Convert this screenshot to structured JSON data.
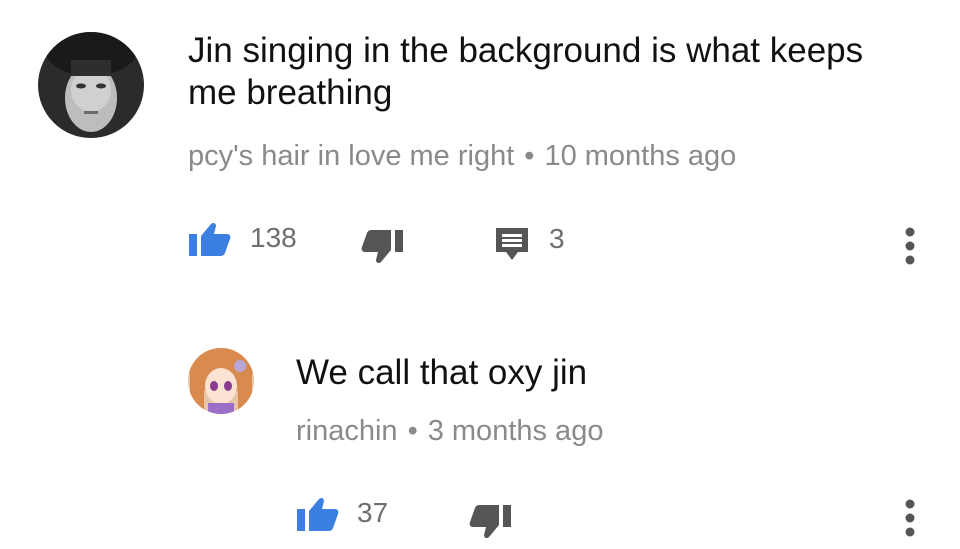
{
  "comment": {
    "text": "Jin singing in the background is what keeps me breathing",
    "author": "pcy's hair in love me right",
    "separator": "•",
    "time": "10 months ago",
    "likes": "138",
    "replies": "3"
  },
  "reply": {
    "text": "We call that oxy jin",
    "author": "rinachin",
    "separator": "•",
    "time": "3 months ago",
    "likes": "37"
  },
  "colors": {
    "like_active": "#3b7fe0",
    "icon_gray": "#555555",
    "meta_gray": "#8a8a8a"
  },
  "icons": {
    "like": "thumb-up-icon",
    "dislike": "thumb-down-icon",
    "reply": "comment-icon",
    "menu": "more-vertical-icon"
  }
}
